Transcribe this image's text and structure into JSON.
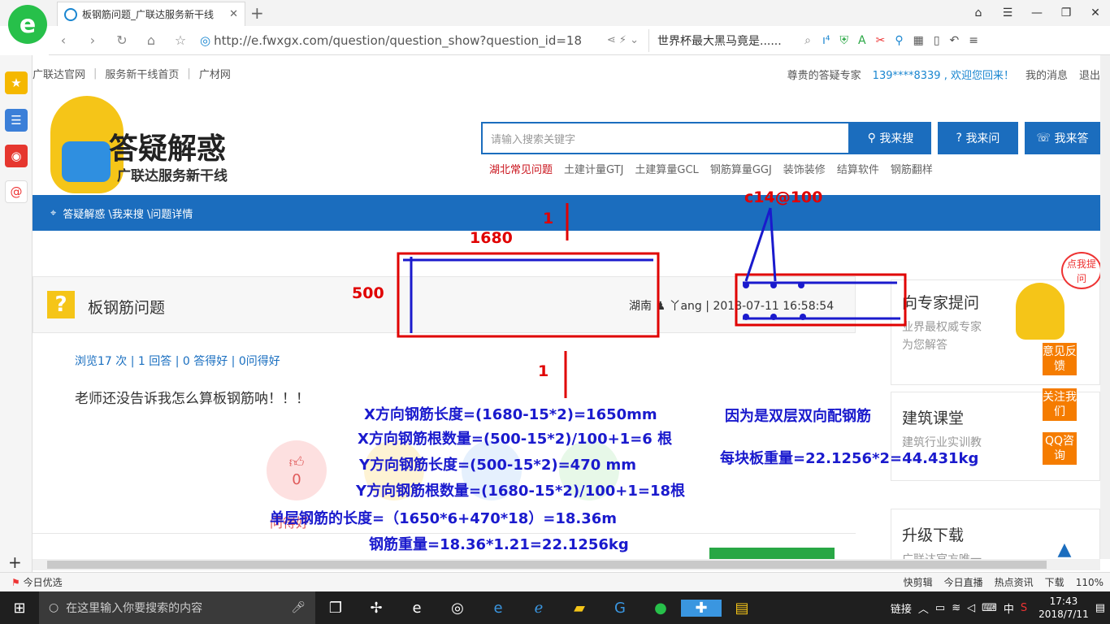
{
  "browser": {
    "tab_title": "板钢筋问题_广联达服务新干线",
    "url": "http://e.fwxgx.com/question/question_show?question_id=18",
    "search_text": "世界杯最大黑马竟是......",
    "logo_letter": "e"
  },
  "page": {
    "toplinks": [
      "广联达官网",
      "服务新干线首页",
      "广材网"
    ],
    "top_right": {
      "expert": "尊贵的答疑专家",
      "user": "139****8339 , 欢迎您回来！",
      "messages": "我的消息",
      "logout": "退出"
    },
    "brand_title": "答疑解惑",
    "brand_sub": "广联达服务新干线",
    "search_placeholder": "请输入搜索关键字",
    "search_btn": "我来搜",
    "ask_btn": "我来问",
    "answer_btn": "我来答",
    "hotlinks": [
      "湖北常见问题",
      "土建计量GTJ",
      "土建算量GCL",
      "钢筋算量GGJ",
      "装饰装修",
      "结算软件",
      "钢筋翻样"
    ],
    "breadcrumb": "答疑解惑 \\我来搜 \\问题详情",
    "question": {
      "title": "板钢筋问题",
      "region": "湖南",
      "user": "丫ang",
      "time": "2018-07-11 16:58:54",
      "stats": "浏览17 次 | 1 回答 | 0 答得好 | 0问得好",
      "body": "老师还没告诉我怎么算板钢筋呐！！！",
      "likes": "0",
      "actions": "问得好"
    },
    "right": {
      "ask_title": "向专家提问",
      "ask_sub1": "业界最权威专家",
      "ask_sub2": "为您解答",
      "course_title": "建筑课堂",
      "course_sub": "建筑行业实训教",
      "download_title": "升级下载",
      "download_sub": "广联达官方唯一",
      "float_top": "点我提问",
      "feedback": "意见反馈",
      "follow": "关注我们",
      "qq": "QQ咨询"
    }
  },
  "annotations": {
    "dim_1680": "1680",
    "dim_500": "500",
    "one_top": "1",
    "one_bottom": "1",
    "rebar_spec": "c14@100",
    "calc_lines": [
      "X方向钢筋长度=(1680-15*2)=1650mm",
      "X方向钢筋根数量=(500-15*2)/100+1=6 根",
      "Y方向钢筋长度=(500-15*2)=470 mm",
      "Y方向钢筋根数量=(1680-15*2)/100+1=18根",
      "单层钢筋的长度=（1650*6+470*18）=18.36m",
      "钢筋重量=18.36*1.21=22.1256kg"
    ],
    "note1": "因为是双层双向配钢筋",
    "note2": "每块板重量=22.1256*2=44.431kg"
  },
  "statusbar": {
    "left": "今日优选",
    "items": [
      "快剪辑",
      "今日直播",
      "热点资讯",
      "下载"
    ],
    "zoom": "110%"
  },
  "taskbar": {
    "search": "在这里输入你要搜索的内容",
    "tray_text": "链接",
    "ime": "中",
    "time": "17:43",
    "date": "2018/7/11"
  },
  "colors": {
    "brand_blue": "#1b6dbe",
    "annotation_red": "#e00000",
    "annotation_blue": "#1a1acd"
  }
}
